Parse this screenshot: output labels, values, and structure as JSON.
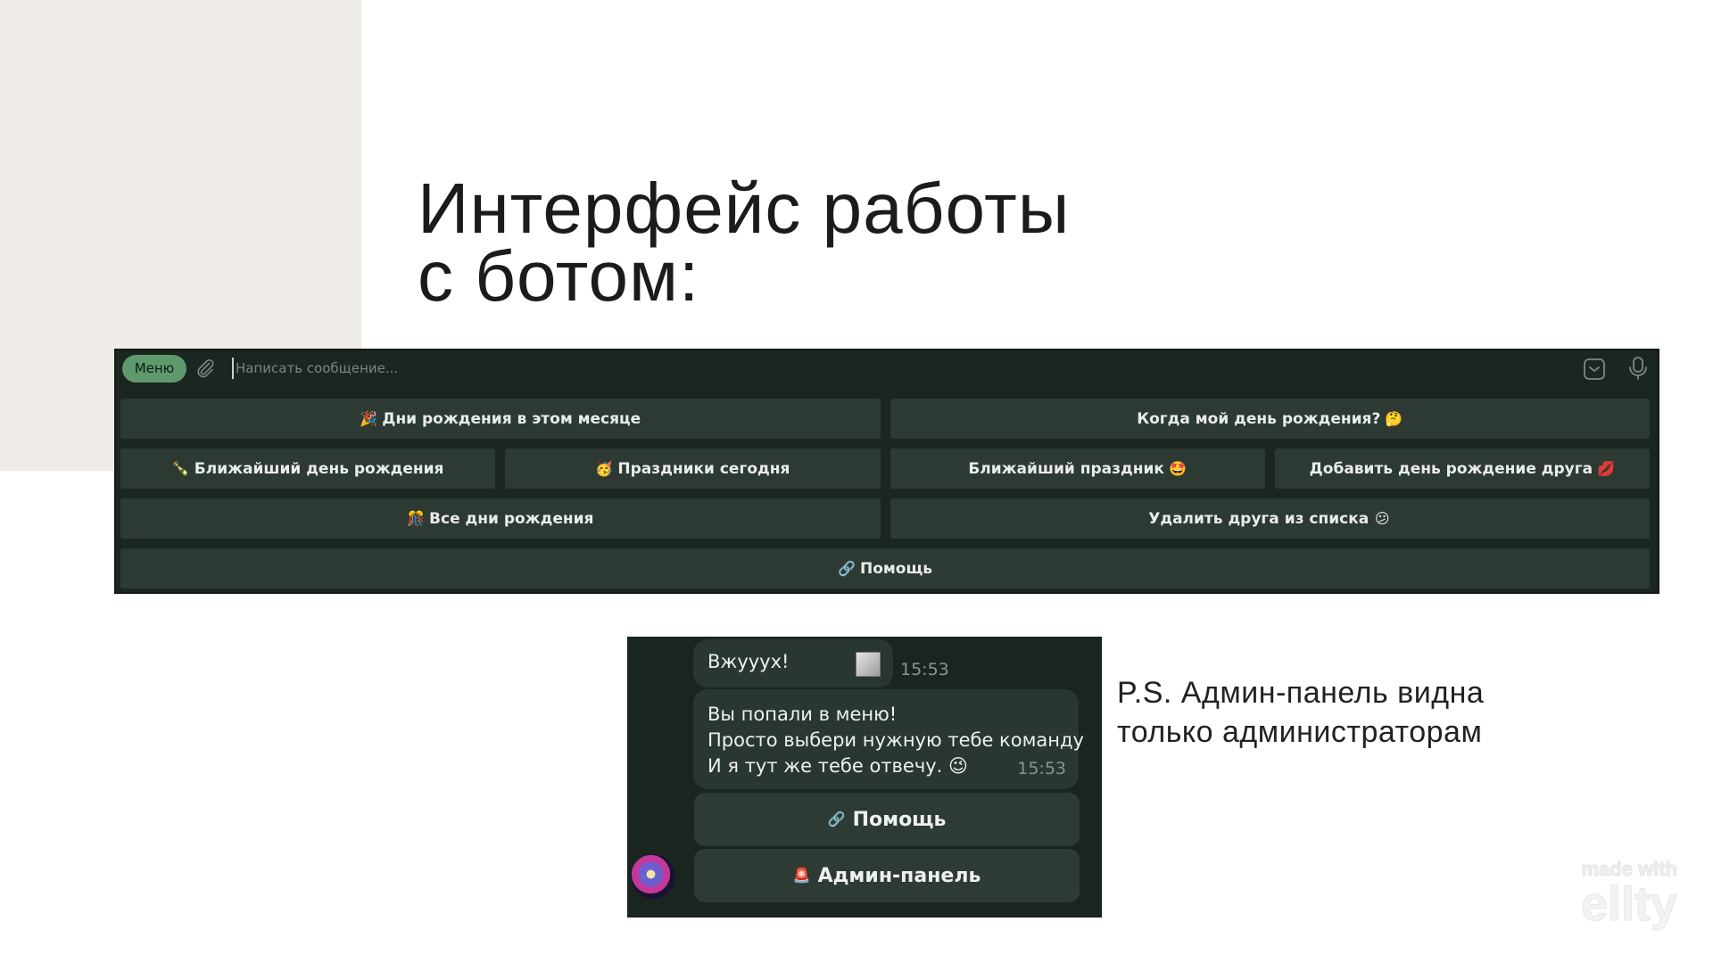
{
  "slide": {
    "title_line1": "Интерфейс работы",
    "title_line2": "с ботом:",
    "note_line1": "P.S. Админ-панель видна",
    "note_line2": "только администраторам",
    "watermark_made": "made with",
    "watermark_brand": "ellty"
  },
  "compose": {
    "menu_label": "Меню",
    "placeholder": "Написать сообщение..."
  },
  "keyboard": {
    "rows": [
      [
        {
          "emoji": "🎉",
          "label": "Дни рождения в этом месяце",
          "emoji_pos": "before"
        },
        {
          "emoji": "🤔",
          "label": "Когда мой день рождения?",
          "emoji_pos": "after"
        }
      ],
      [
        {
          "emoji": "🍾",
          "label": "Ближайший день рождения",
          "emoji_pos": "before"
        },
        {
          "emoji": "🥳",
          "label": "Праздники сегодня",
          "emoji_pos": "before"
        },
        {
          "emoji": "🤩",
          "label": "Ближайший праздник",
          "emoji_pos": "after"
        },
        {
          "emoji": "💋",
          "label": "Добавить день рождение друга",
          "emoji_pos": "after"
        }
      ],
      [
        {
          "emoji": "🎊",
          "label": "Все дни рождения",
          "emoji_pos": "before"
        },
        {
          "emoji": "😕",
          "label": "Удалить друга из списка",
          "emoji_pos": "after"
        }
      ],
      [
        {
          "emoji": "🔗",
          "label": "Помощь",
          "emoji_pos": "before"
        }
      ]
    ]
  },
  "chat": {
    "msg1_text": "Вжуууx!",
    "msg1_time": "15:53",
    "msg2_line1": "Вы попали в меню!",
    "msg2_line2": "Просто выбери нужную тебе команду",
    "msg2_line3": "И я тут же тебе отвечу. 😉",
    "msg2_time": "15:53",
    "btn_help_emoji": "🔗",
    "btn_help_label": "Помощь",
    "btn_admin_emoji": "🚨",
    "btn_admin_label": "Админ-панель"
  }
}
